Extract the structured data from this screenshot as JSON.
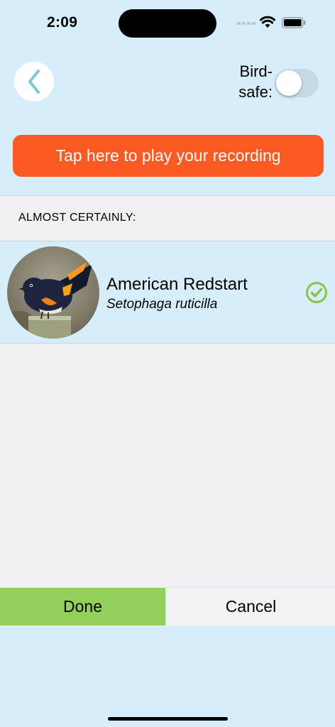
{
  "status_bar": {
    "time": "2:09",
    "icons": [
      "cellular-signal-icon",
      "wifi-icon",
      "battery-icon"
    ]
  },
  "header": {
    "back_icon": "chevron-left-icon",
    "bird_safe_label": "Bird-safe:",
    "bird_safe_enabled": false
  },
  "play_button": {
    "label": "Tap here to play your recording",
    "color": "#fc5a22"
  },
  "results": {
    "section_title": "ALMOST CERTAINLY:",
    "items": [
      {
        "common_name": "American Redstart",
        "scientific_name": "Setophaga ruticilla",
        "selected": true,
        "photo_icon": "bird-photo"
      }
    ]
  },
  "footer": {
    "done_label": "Done",
    "cancel_label": "Cancel",
    "done_color": "#92d05b"
  },
  "colors": {
    "background": "#d6eefa",
    "list_background": "#efeff4",
    "back_chevron": "#7ec9d6",
    "check": "#8bc53f"
  }
}
